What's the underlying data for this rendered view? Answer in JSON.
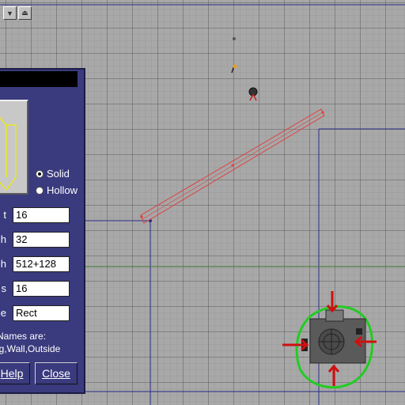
{
  "toolbar": {
    "icons": [
      "dropdown-arrow-icon",
      "stamp-icon"
    ]
  },
  "dialog": {
    "preview_icon": "wireframe-cube-icon",
    "shape_options": [
      {
        "label": "Solid",
        "checked": true
      },
      {
        "label": "Hollow",
        "checked": false
      }
    ],
    "fields": [
      {
        "label": "t",
        "value": "16"
      },
      {
        "label": "h",
        "value": "32"
      },
      {
        "label": "h",
        "value": "512+128"
      },
      {
        "label": "s",
        "value": "16"
      },
      {
        "label": "e",
        "value": "Rect"
      }
    ],
    "names_heading": "Names are:",
    "names_list": "ng,Wall,Outside",
    "buttons": {
      "help": "Help",
      "close": "Close"
    }
  },
  "viewport": {
    "colors": {
      "grid_background": "#a8a8a8",
      "grid_line": "#7a7a7a",
      "blue_line": "#2a2a8a",
      "green_line": "#3a7a2a",
      "selection": "#e04040",
      "highlight": "#22cc22",
      "arrow": "#d01010"
    },
    "objects": [
      "light-entity-icon",
      "player-start-icon",
      "red-selected-brush",
      "green-outlined-entity"
    ]
  }
}
